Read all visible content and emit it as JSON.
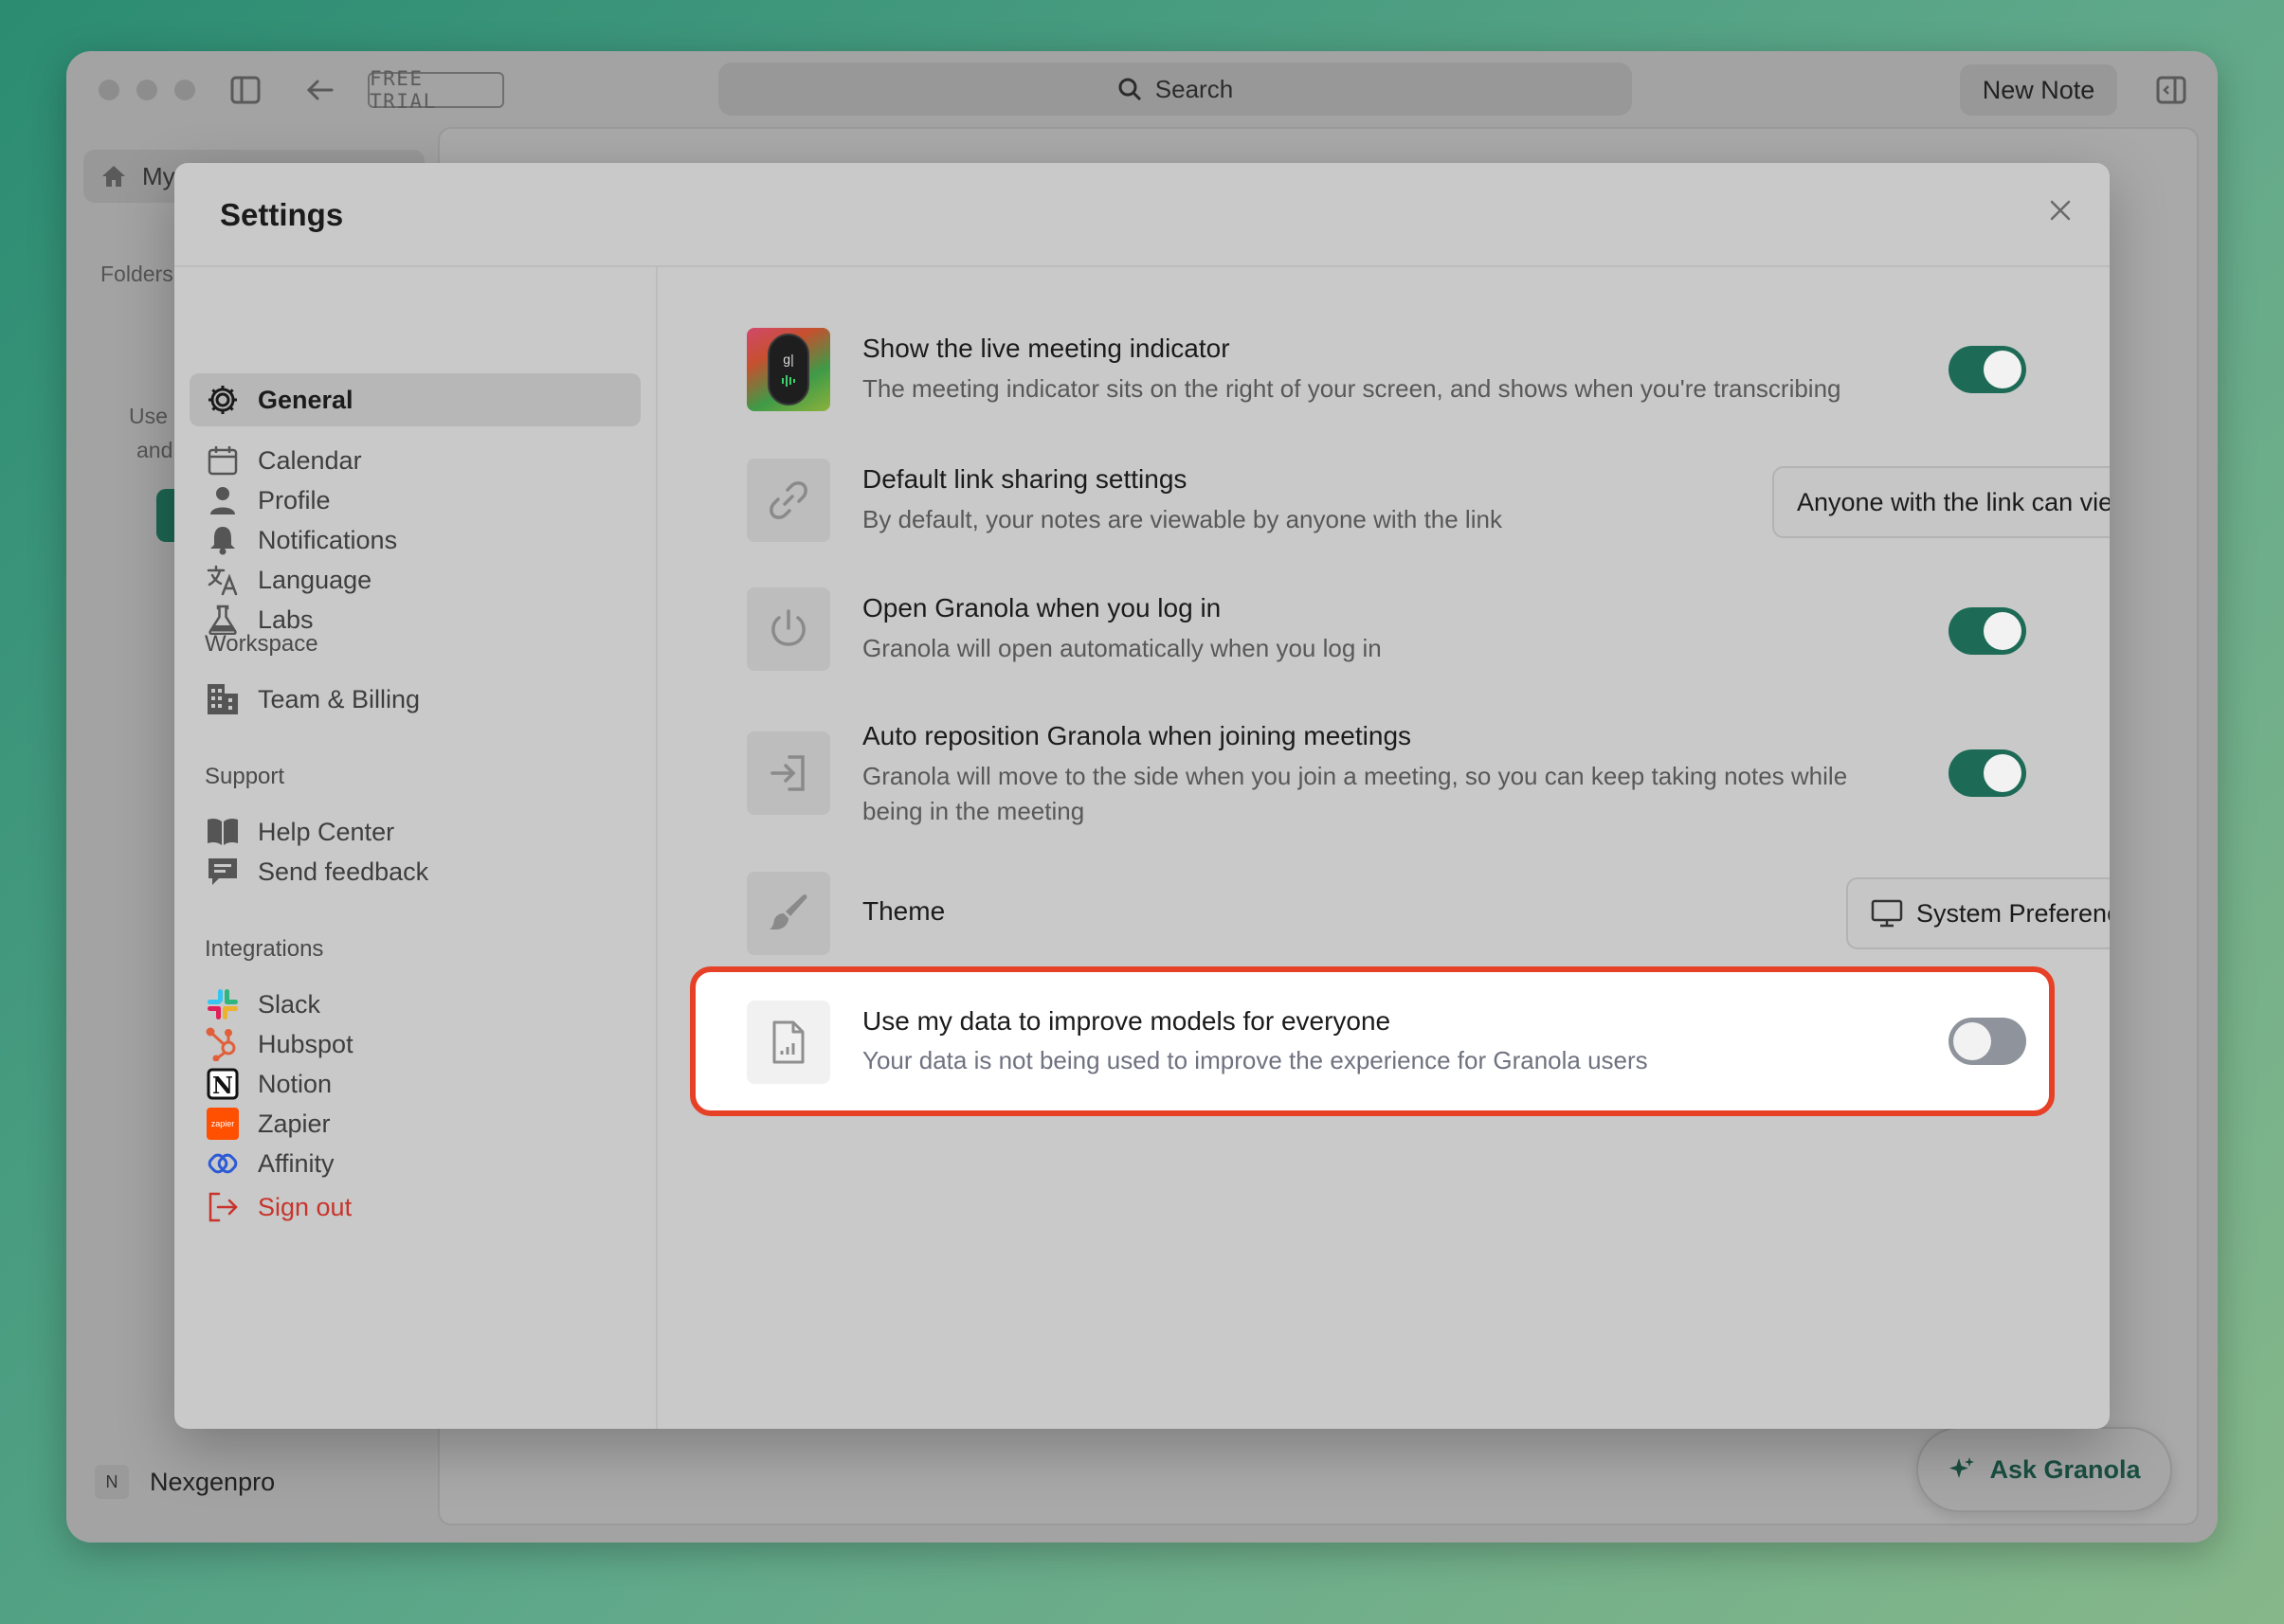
{
  "window": {
    "free_trial": "FREE TRIAL",
    "search_placeholder": "Search",
    "new_note": "New Note",
    "sidebar_home": "My",
    "folders_label": "Folders",
    "bg_text_1": "Use",
    "bg_text_2": "and",
    "workspace_initial": "N",
    "workspace_name": "Nexgenpro",
    "ask_granola": "Ask Granola"
  },
  "modal": {
    "title": "Settings"
  },
  "nav": {
    "items": [
      {
        "label": "General",
        "icon": "gear-icon",
        "active": true
      },
      {
        "label": "Calendar",
        "icon": "calendar-icon"
      },
      {
        "label": "Profile",
        "icon": "person-icon"
      },
      {
        "label": "Notifications",
        "icon": "bell-icon"
      },
      {
        "label": "Language",
        "icon": "translate-icon"
      },
      {
        "label": "Labs",
        "icon": "flask-icon"
      }
    ],
    "workspace_section": "Workspace",
    "workspace_items": [
      {
        "label": "Team & Billing",
        "icon": "building-icon"
      }
    ],
    "support_section": "Support",
    "support_items": [
      {
        "label": "Help Center",
        "icon": "book-icon"
      },
      {
        "label": "Send feedback",
        "icon": "feedback-icon"
      }
    ],
    "integrations_section": "Integrations",
    "integration_items": [
      {
        "label": "Slack",
        "icon": "slack-icon"
      },
      {
        "label": "Hubspot",
        "icon": "hubspot-icon"
      },
      {
        "label": "Notion",
        "icon": "notion-icon"
      },
      {
        "label": "Zapier",
        "icon": "zapier-icon",
        "badge": "zapier"
      },
      {
        "label": "Affinity",
        "icon": "affinity-icon"
      }
    ],
    "sign_out": "Sign out"
  },
  "settings": {
    "meeting_indicator": {
      "title": "Show the live meeting indicator",
      "desc": "The meeting indicator sits on the right of your screen, and shows when you're transcribing",
      "enabled": true
    },
    "link_sharing": {
      "title": "Default link sharing settings",
      "desc": "By default, your notes are viewable by anyone with the link",
      "selected": "Anyone with the link can view"
    },
    "open_on_login": {
      "title": "Open Granola when you log in",
      "desc": "Granola will open automatically when you log in",
      "enabled": true
    },
    "auto_reposition": {
      "title": "Auto reposition Granola when joining meetings",
      "desc": "Granola will move to the side when you join a meeting, so you can keep taking notes while being in the meeting",
      "enabled": true
    },
    "theme": {
      "title": "Theme",
      "selected": "System Preference"
    },
    "data_usage": {
      "title": "Use my data to improve models for everyone",
      "desc": "Your data is not being used to improve the experience for Granola users",
      "enabled": false
    }
  },
  "colors": {
    "accent": "#1d6a57",
    "highlight": "#e64027",
    "toggle_off": "#8e939c",
    "sign_out": "#c8342b"
  }
}
